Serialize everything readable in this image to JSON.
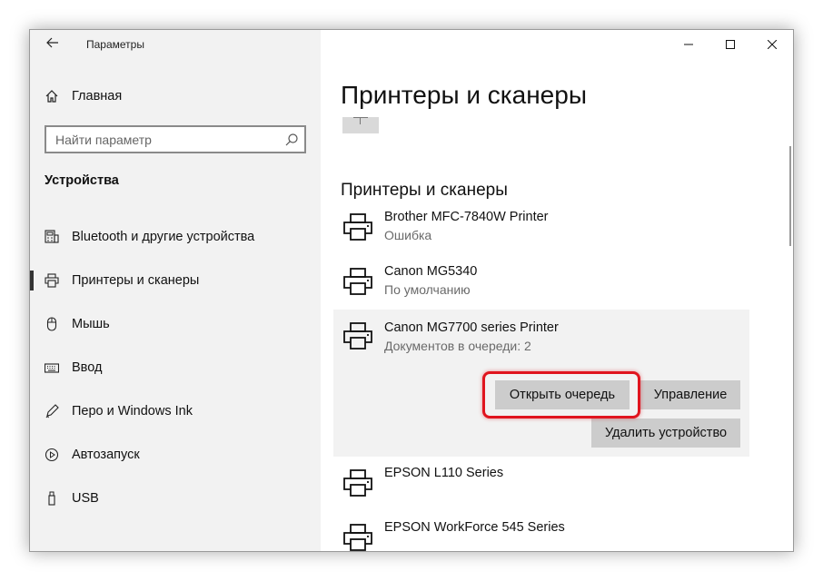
{
  "window": {
    "title": "Параметры",
    "back_icon": "arrow-left-icon",
    "controls": [
      "minimize-icon",
      "maximize-icon",
      "close-icon"
    ]
  },
  "sidebar": {
    "home_label": "Главная",
    "search": {
      "placeholder": "Найти параметр",
      "value": ""
    },
    "section_title": "Устройства",
    "items": [
      {
        "label": "Bluetooth и другие устройства",
        "icon": "bluetooth-devices-icon",
        "active": false
      },
      {
        "label": "Принтеры и сканеры",
        "icon": "printer-icon",
        "active": true
      },
      {
        "label": "Мышь",
        "icon": "mouse-icon",
        "active": false
      },
      {
        "label": "Ввод",
        "icon": "keyboard-icon",
        "active": false
      },
      {
        "label": "Перо и Windows Ink",
        "icon": "pen-icon",
        "active": false
      },
      {
        "label": "Автозапуск",
        "icon": "autoplay-icon",
        "active": false
      },
      {
        "label": "USB",
        "icon": "usb-icon",
        "active": false
      }
    ]
  },
  "main": {
    "page_title": "Принтеры и сканеры",
    "section_title": "Принтеры и сканеры",
    "printers": [
      {
        "name": "Brother MFC-7840W Printer",
        "status": "Ошибка"
      },
      {
        "name": "Canon MG5340",
        "status": "По умолчанию"
      },
      {
        "name": "Canon MG7700 series Printer",
        "status": "Документов в очереди: 2"
      },
      {
        "name": "EPSON L110 Series",
        "status": ""
      },
      {
        "name": "EPSON WorkForce 545 Series",
        "status": ""
      }
    ],
    "actions": {
      "open_queue": "Открыть очередь",
      "manage": "Управление",
      "remove": "Удалить устройство"
    }
  },
  "colors": {
    "sidebar_bg": "#f2f2f2",
    "button_bg": "#cccccc",
    "highlight": "#e0141e",
    "status_text": "#6a6a6a"
  }
}
